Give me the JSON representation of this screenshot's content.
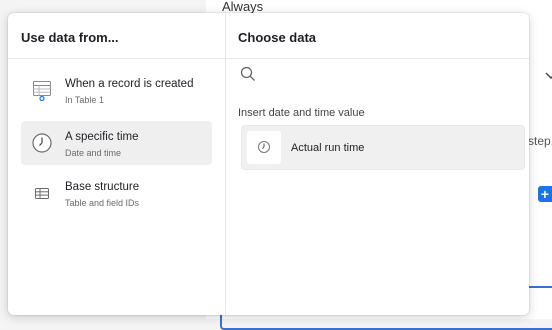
{
  "background": {
    "top_label": "Always",
    "step_text": "step,"
  },
  "left_pane": {
    "title": "Use data from...",
    "items": [
      {
        "title": "When a record is created",
        "subtitle": "In Table 1",
        "icon": "table-record-icon"
      },
      {
        "title": "A specific time",
        "subtitle": "Date and time",
        "icon": "clock-icon",
        "selected": true
      },
      {
        "title": "Base structure",
        "subtitle": "Table and field IDs",
        "icon": "table-grid-icon"
      }
    ]
  },
  "right_pane": {
    "title": "Choose data",
    "search": {
      "placeholder": "",
      "value": ""
    },
    "section_label": "Insert date and time value",
    "options": [
      {
        "label": "Actual run time",
        "icon": "clock-icon"
      }
    ]
  },
  "colors": {
    "accent": "#1a73e8",
    "selected_bg": "#efefef",
    "focus_border": "#3b6fd6"
  }
}
